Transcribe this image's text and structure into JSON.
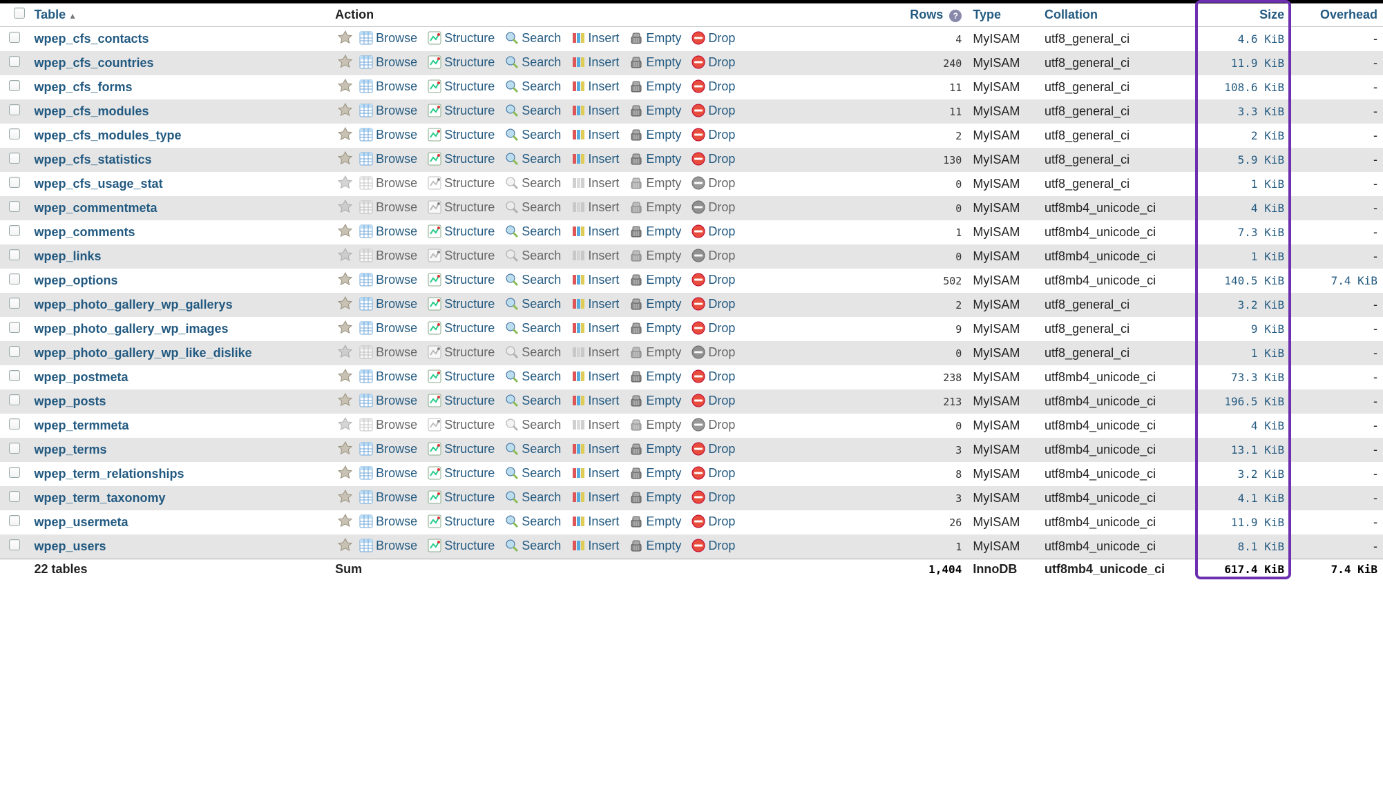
{
  "headers": {
    "table": "Table",
    "action": "Action",
    "rows": "Rows",
    "type": "Type",
    "collation": "Collation",
    "size": "Size",
    "overhead": "Overhead"
  },
  "actions": {
    "browse": "Browse",
    "structure": "Structure",
    "search": "Search",
    "insert": "Insert",
    "empty": "Empty",
    "drop": "Drop"
  },
  "rows": [
    {
      "name": "wpep_cfs_contacts",
      "rows": "4",
      "type": "MyISAM",
      "collation": "utf8_general_ci",
      "size": "4.6 KiB",
      "overhead": "-",
      "enabled": true
    },
    {
      "name": "wpep_cfs_countries",
      "rows": "240",
      "type": "MyISAM",
      "collation": "utf8_general_ci",
      "size": "11.9 KiB",
      "overhead": "-",
      "enabled": true
    },
    {
      "name": "wpep_cfs_forms",
      "rows": "11",
      "type": "MyISAM",
      "collation": "utf8_general_ci",
      "size": "108.6 KiB",
      "overhead": "-",
      "enabled": true
    },
    {
      "name": "wpep_cfs_modules",
      "rows": "11",
      "type": "MyISAM",
      "collation": "utf8_general_ci",
      "size": "3.3 KiB",
      "overhead": "-",
      "enabled": true
    },
    {
      "name": "wpep_cfs_modules_type",
      "rows": "2",
      "type": "MyISAM",
      "collation": "utf8_general_ci",
      "size": "2 KiB",
      "overhead": "-",
      "enabled": true
    },
    {
      "name": "wpep_cfs_statistics",
      "rows": "130",
      "type": "MyISAM",
      "collation": "utf8_general_ci",
      "size": "5.9 KiB",
      "overhead": "-",
      "enabled": true
    },
    {
      "name": "wpep_cfs_usage_stat",
      "rows": "0",
      "type": "MyISAM",
      "collation": "utf8_general_ci",
      "size": "1 KiB",
      "overhead": "-",
      "enabled": false
    },
    {
      "name": "wpep_commentmeta",
      "rows": "0",
      "type": "MyISAM",
      "collation": "utf8mb4_unicode_ci",
      "size": "4 KiB",
      "overhead": "-",
      "enabled": false
    },
    {
      "name": "wpep_comments",
      "rows": "1",
      "type": "MyISAM",
      "collation": "utf8mb4_unicode_ci",
      "size": "7.3 KiB",
      "overhead": "-",
      "enabled": true
    },
    {
      "name": "wpep_links",
      "rows": "0",
      "type": "MyISAM",
      "collation": "utf8mb4_unicode_ci",
      "size": "1 KiB",
      "overhead": "-",
      "enabled": false
    },
    {
      "name": "wpep_options",
      "rows": "502",
      "type": "MyISAM",
      "collation": "utf8mb4_unicode_ci",
      "size": "140.5 KiB",
      "overhead": "7.4 KiB",
      "enabled": true
    },
    {
      "name": "wpep_photo_gallery_wp_gallerys",
      "rows": "2",
      "type": "MyISAM",
      "collation": "utf8_general_ci",
      "size": "3.2 KiB",
      "overhead": "-",
      "enabled": true
    },
    {
      "name": "wpep_photo_gallery_wp_images",
      "rows": "9",
      "type": "MyISAM",
      "collation": "utf8_general_ci",
      "size": "9 KiB",
      "overhead": "-",
      "enabled": true
    },
    {
      "name": "wpep_photo_gallery_wp_like_dislike",
      "rows": "0",
      "type": "MyISAM",
      "collation": "utf8_general_ci",
      "size": "1 KiB",
      "overhead": "-",
      "enabled": false
    },
    {
      "name": "wpep_postmeta",
      "rows": "238",
      "type": "MyISAM",
      "collation": "utf8mb4_unicode_ci",
      "size": "73.3 KiB",
      "overhead": "-",
      "enabled": true
    },
    {
      "name": "wpep_posts",
      "rows": "213",
      "type": "MyISAM",
      "collation": "utf8mb4_unicode_ci",
      "size": "196.5 KiB",
      "overhead": "-",
      "enabled": true
    },
    {
      "name": "wpep_termmeta",
      "rows": "0",
      "type": "MyISAM",
      "collation": "utf8mb4_unicode_ci",
      "size": "4 KiB",
      "overhead": "-",
      "enabled": false
    },
    {
      "name": "wpep_terms",
      "rows": "3",
      "type": "MyISAM",
      "collation": "utf8mb4_unicode_ci",
      "size": "13.1 KiB",
      "overhead": "-",
      "enabled": true
    },
    {
      "name": "wpep_term_relationships",
      "rows": "8",
      "type": "MyISAM",
      "collation": "utf8mb4_unicode_ci",
      "size": "3.2 KiB",
      "overhead": "-",
      "enabled": true
    },
    {
      "name": "wpep_term_taxonomy",
      "rows": "3",
      "type": "MyISAM",
      "collation": "utf8mb4_unicode_ci",
      "size": "4.1 KiB",
      "overhead": "-",
      "enabled": true
    },
    {
      "name": "wpep_usermeta",
      "rows": "26",
      "type": "MyISAM",
      "collation": "utf8mb4_unicode_ci",
      "size": "11.9 KiB",
      "overhead": "-",
      "enabled": true
    },
    {
      "name": "wpep_users",
      "rows": "1",
      "type": "MyISAM",
      "collation": "utf8mb4_unicode_ci",
      "size": "8.1 KiB",
      "overhead": "-",
      "enabled": true
    }
  ],
  "summary": {
    "label": "22 tables",
    "action": "Sum",
    "rows": "1,404",
    "type": "InnoDB",
    "collation": "utf8mb4_unicode_ci",
    "size": "617.4 KiB",
    "overhead": "7.4 KiB"
  }
}
